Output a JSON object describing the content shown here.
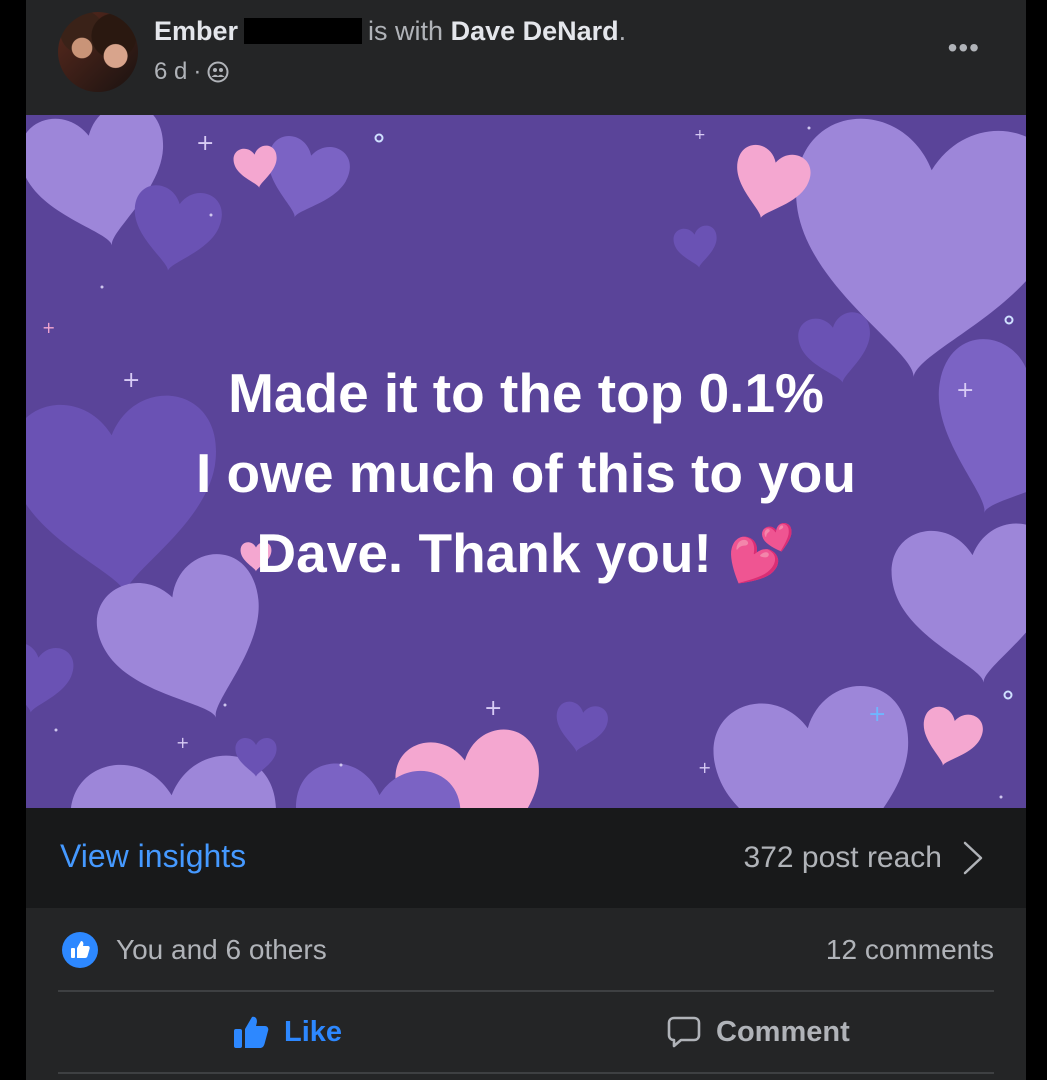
{
  "post": {
    "author": "Ember",
    "with_text": "is with",
    "tagged": "Dave DeNard",
    "period": ".",
    "time": "6 d",
    "separator": "·",
    "more_label": "•••"
  },
  "image": {
    "lines": [
      "Made it to the top 0.1%",
      "I owe much of this to you",
      "Dave. Thank you! 💕"
    ],
    "background_color": "#5a4499"
  },
  "insights": {
    "link": "View insights",
    "reach": "372 post reach"
  },
  "reactions": {
    "text": "You and 6 others",
    "comments": "12 comments"
  },
  "actions": {
    "like": "Like",
    "comment": "Comment"
  },
  "colors": {
    "accent": "#2d88ff",
    "link": "#4599ff",
    "card": "#242526"
  }
}
